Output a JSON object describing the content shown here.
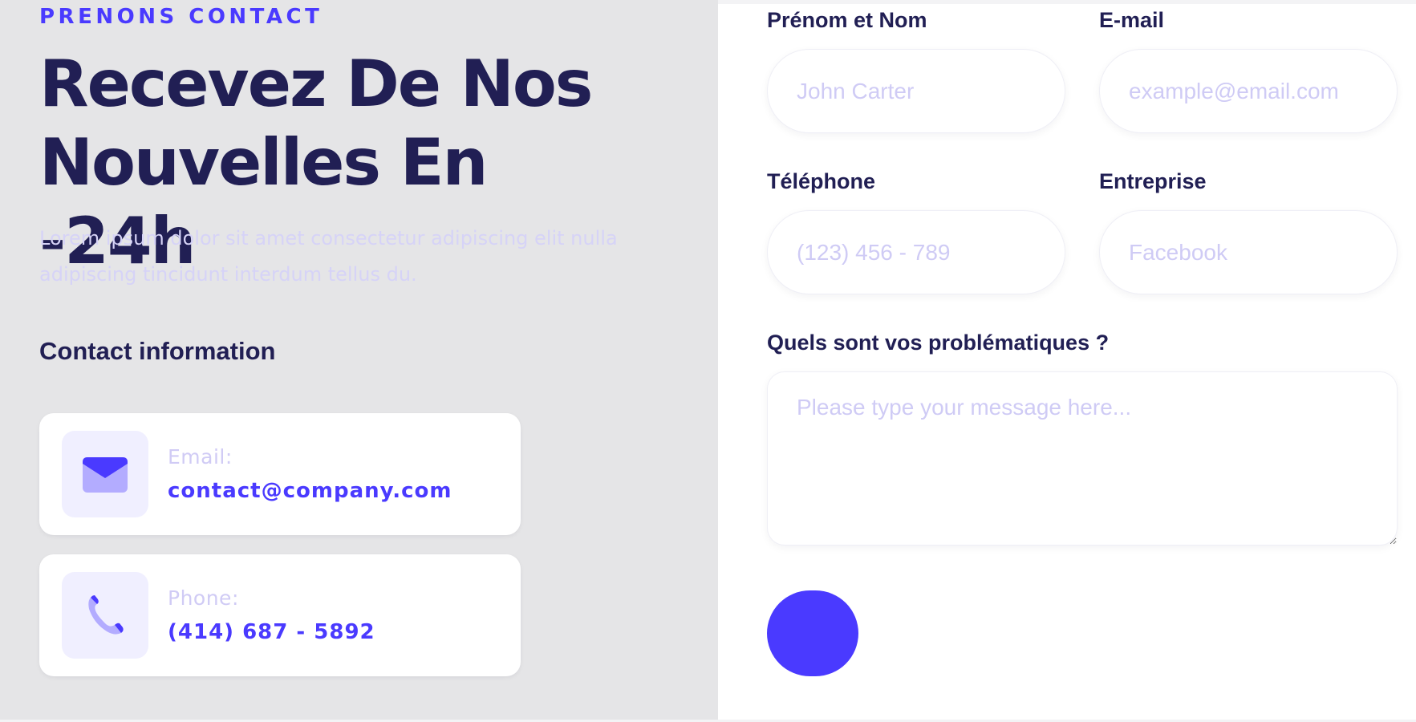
{
  "left": {
    "eyebrow": "PRENONS CONTACT",
    "heading_line1": "Recevez De Nos",
    "heading_line2": "Nouvelles En -24h",
    "lead": "Lorem ipsum dolor sit amet consectetur adipiscing elit nulla adipiscing tincidunt interdum tellus du.",
    "contact_title": "Contact information",
    "cards": [
      {
        "icon": "envelope-icon",
        "label": "Email:",
        "value": "contact@company.com"
      },
      {
        "icon": "phone-icon",
        "label": "Phone:",
        "value": "(414) 687 - 5892"
      }
    ]
  },
  "form": {
    "name_label": "Prénom et Nom",
    "name_placeholder": "John Carter",
    "email_label": "E-mail",
    "email_placeholder": "example@email.com",
    "phone_label": "Téléphone",
    "phone_placeholder": "(123) 456 - 789",
    "company_label": "Entreprise",
    "company_placeholder": "Facebook",
    "message_label": "Quels sont vos problématiques ?",
    "message_placeholder": "Please type your message here..."
  },
  "colors": {
    "accent": "#4a3aff",
    "heading": "#211f54",
    "muted": "#d6d3f7",
    "panel_bg": "#e5e5e7"
  }
}
